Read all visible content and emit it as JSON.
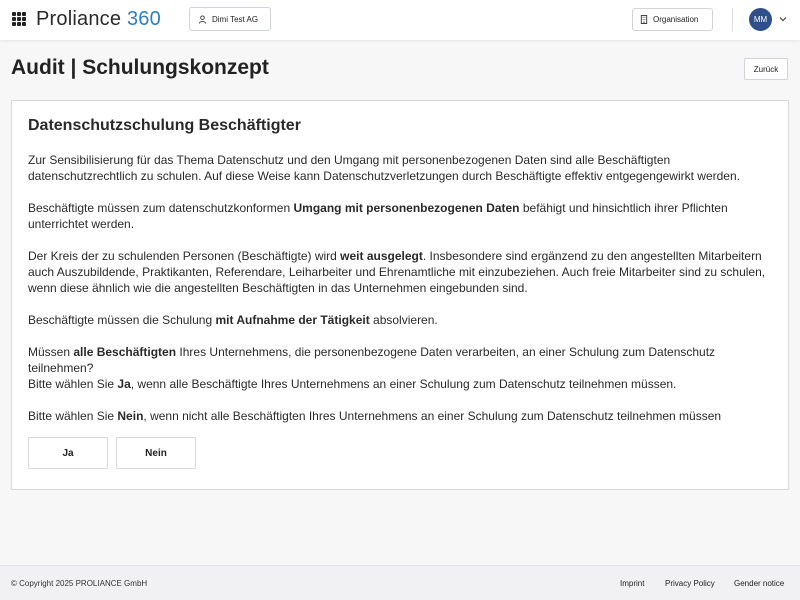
{
  "header": {
    "brand_name": "Proliance",
    "brand_number": "360",
    "tenant_label": "Dimi Test AG",
    "organisation_label": "Organisation",
    "avatar_initials": "MM"
  },
  "page": {
    "title": "Audit | Schulungskonzept",
    "back_label": "Zurück"
  },
  "card": {
    "heading": "Datenschutzschulung Beschäftigter",
    "p1": "Zur Sensibilisierung für das Thema Datenschutz und den Umgang mit personenbezogenen Daten sind alle Beschäftigten datenschutzrechtlich zu schulen. Auf diese Weise kann Datenschutzverletzungen durch Beschäftigte effektiv entgegengewirkt werden.",
    "p2": {
      "a": "Beschäftigte müssen zum datenschutzkonformen ",
      "b": "Umgang mit personenbezogenen Daten",
      "c": " befähigt und hinsichtlich ihrer Pflichten unterrichtet werden."
    },
    "p3": {
      "a": "Der Kreis der zu schulenden Personen (Beschäftigte) wird ",
      "b": "weit ausgelegt",
      "c": ". Insbesondere sind ergänzend zu den angestellten Mitarbeitern auch Auszubildende, Praktikanten, Referendare, Leiharbeiter und Ehrenamtliche mit einzubeziehen. Auch freie Mitarbeiter sind zu schulen, wenn diese ähnlich wie die angestellten Beschäftigten in das Unternehmen eingebunden sind."
    },
    "p4": {
      "a": "Beschäftigte müssen die Schulung ",
      "b": "mit Aufnahme der Tätigkeit",
      "c": " absolvieren."
    },
    "p5": {
      "a": "Müssen ",
      "b": "alle Beschäftigten",
      "c": " Ihres Unternehmens, die personenbezogene Daten verarbeiten, an einer Schulung zum Datenschutz teilnehmen?"
    },
    "p6": {
      "a": "Bitte wählen Sie ",
      "b": "Ja",
      "c": ", wenn alle Beschäftigte Ihres Unternehmens an einer Schulung zum Datenschutz teilnehmen müssen."
    },
    "p7": {
      "a": "Bitte wählen Sie ",
      "b": "Nein",
      "c": ", wenn nicht alle Beschäftigten Ihres Unternehmens an einer Schulung zum Datenschutz teilnehmen müssen"
    },
    "yes_label": "Ja",
    "no_label": "Nein"
  },
  "footer": {
    "copyright": "© Copyright 2025 PROLIANCE GmbH",
    "imprint": "Imprint",
    "privacy": "Privacy Policy",
    "gender": "Gender notice"
  },
  "colors": {
    "brand_accent": "#2d7fc1",
    "avatar_bg": "#2e4f8a"
  },
  "icons": [
    "apps-grid-icon",
    "user-icon",
    "building-icon",
    "chevron-down-icon"
  ]
}
